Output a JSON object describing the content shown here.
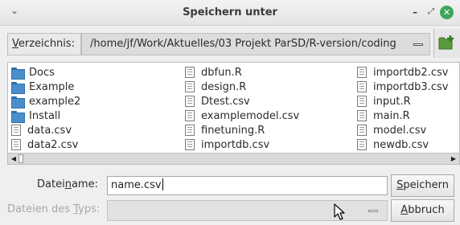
{
  "window": {
    "title": "Speichern unter",
    "menu_icon": "chevron-down-icon",
    "minimize_glyph": "–",
    "maximize_glyph": "⤢",
    "close_glyph": "✕",
    "close_color": "#3ba55c"
  },
  "directory": {
    "label_pre": "",
    "label_ul": "V",
    "label_post": "erzeichnis:",
    "path": "/home/jf/Work/Aktuelles/03 Projekt ParSD/R-version/coding",
    "new_folder_icon": "new-folder-icon"
  },
  "files": {
    "column1": [
      {
        "name": "Docs",
        "type": "folder"
      },
      {
        "name": "Example",
        "type": "folder"
      },
      {
        "name": "example2",
        "type": "folder"
      },
      {
        "name": "Install",
        "type": "folder"
      },
      {
        "name": "data.csv",
        "type": "file"
      },
      {
        "name": "data2.csv",
        "type": "file"
      }
    ],
    "column2": [
      {
        "name": "dbfun.R",
        "type": "file"
      },
      {
        "name": "design.R",
        "type": "file"
      },
      {
        "name": "Dtest.csv",
        "type": "file"
      },
      {
        "name": "examplemodel.csv",
        "type": "file"
      },
      {
        "name": "finetuning.R",
        "type": "file"
      },
      {
        "name": "importdb.csv",
        "type": "file"
      }
    ],
    "column3": [
      {
        "name": "importdb2.csv",
        "type": "file"
      },
      {
        "name": "importdb3.csv",
        "type": "file"
      },
      {
        "name": "input.R",
        "type": "file"
      },
      {
        "name": "main.R",
        "type": "file"
      },
      {
        "name": "model.csv",
        "type": "file"
      },
      {
        "name": "newdb.csv",
        "type": "file"
      }
    ]
  },
  "filename": {
    "label_pre": "Datei",
    "label_ul": "n",
    "label_post": "ame:",
    "value": "name.csv"
  },
  "filetype": {
    "label_pre": "Dateien des ",
    "label_ul": "T",
    "label_post": "yps:",
    "value": ""
  },
  "buttons": {
    "save_ul": "S",
    "save_post": "peichern",
    "cancel_ul": "A",
    "cancel_post": "bbruch"
  },
  "colors": {
    "folder": "#4a8fcc",
    "window_bg": "#efefef"
  }
}
